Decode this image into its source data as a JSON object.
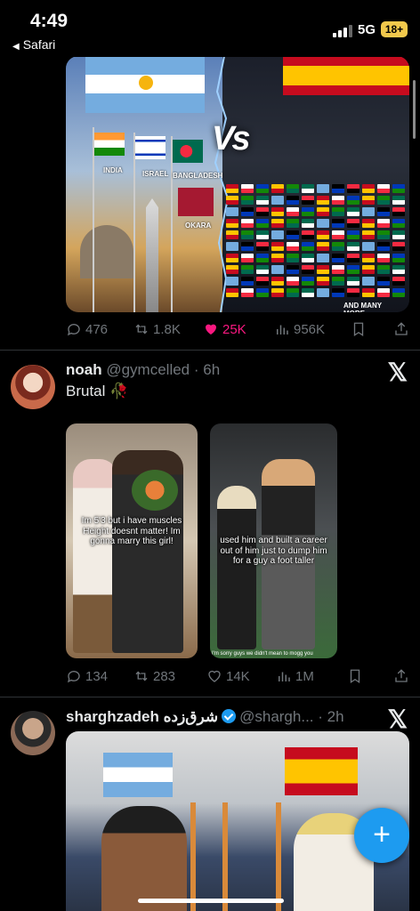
{
  "status_bar": {
    "time": "4:49",
    "back_app": "Safari",
    "network": "5G",
    "battery": "18+"
  },
  "post1": {
    "image_text": {
      "vs": "Vs",
      "left_labels": [
        "INDIA",
        "ISRAEL",
        "BANGLADESH",
        "OKARA"
      ],
      "more": "AND MANY MORE..."
    },
    "replies": "476",
    "reposts": "1.8K",
    "likes": "25K",
    "views": "956K",
    "liked": true
  },
  "post2": {
    "name": "noah",
    "handle": "@gymcelled",
    "time": "6h",
    "text": "Brutal",
    "emoji": "🥀",
    "left_caption": "Im 5'3 but i have muscles Height doesnt matter! Im gonna marry this girl!",
    "right_caption": "used him and built a career out of him just to dump him for a guy a foot taller",
    "right_subtitle": "I'm sorry guys we didn't mean to mogg you",
    "replies": "134",
    "reposts": "283",
    "likes": "14K",
    "views": "1M"
  },
  "post3": {
    "name": "sharghzadeh شرق‌زده",
    "handle": "@shargh...",
    "time": "2h",
    "verified": true
  },
  "fab": {
    "label": "+"
  },
  "colors": {
    "accent": "#1d9bf0",
    "like": "#f91880",
    "muted": "#71767b",
    "background": "#000000"
  }
}
